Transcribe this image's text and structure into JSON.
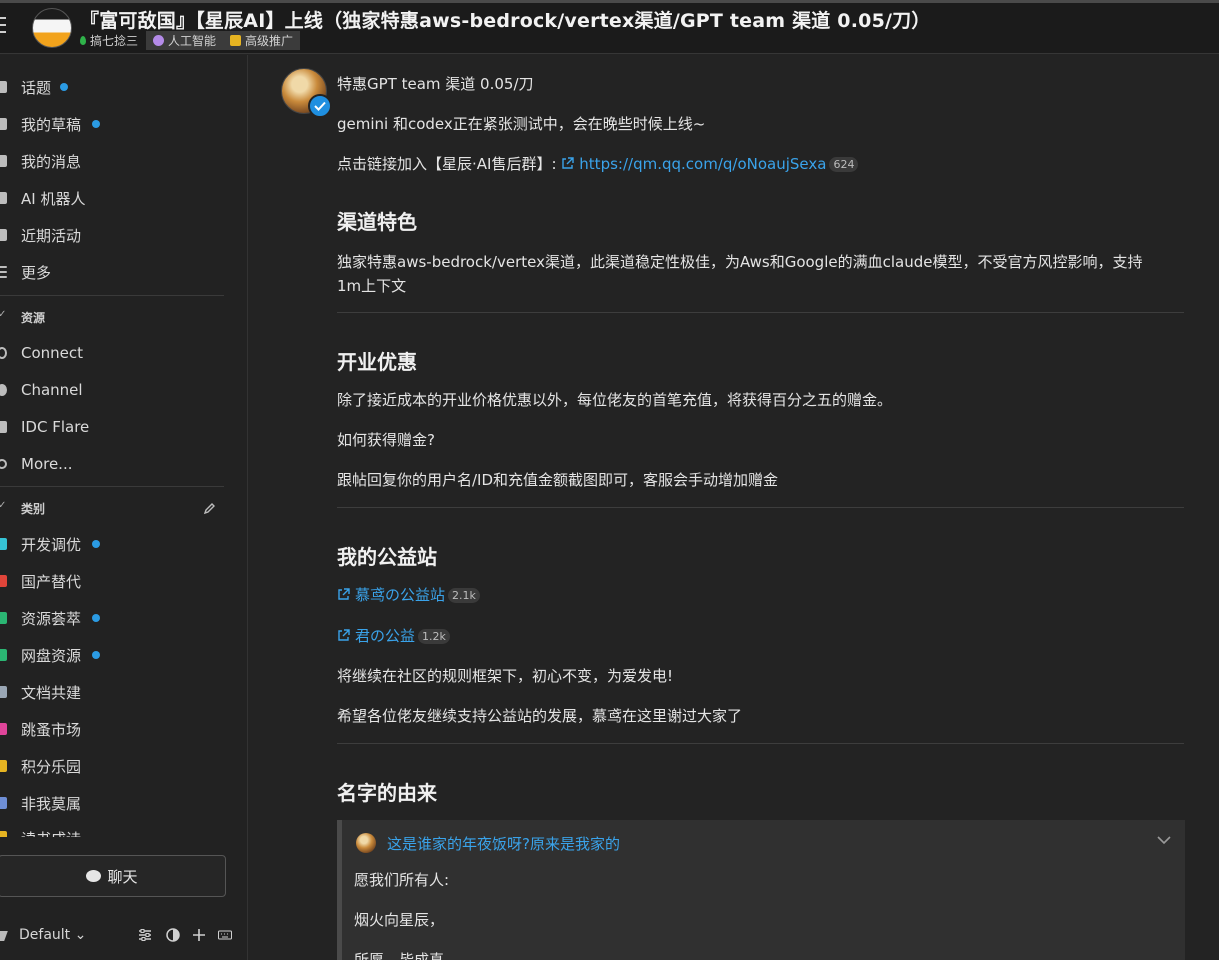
{
  "header": {
    "title": "『富可敌国』【星辰AI】上线（独家特惠aws-bedrock/vertex渠道/GPT team 渠道 0.05/刀）",
    "category": "搞七捻三",
    "tags": [
      "人工智能",
      "高级推广"
    ]
  },
  "sidebar": {
    "nav": [
      {
        "label": "话题",
        "unread": true
      },
      {
        "label": "我的草稿",
        "unread": true
      },
      {
        "label": "我的消息",
        "unread": false
      },
      {
        "label": "AI 机器人",
        "unread": false
      },
      {
        "label": "近期活动",
        "unread": false
      },
      {
        "label": "更多",
        "unread": false
      }
    ],
    "resources_heading": "资源",
    "resources": [
      "Connect",
      "Channel",
      "IDC Flare",
      "More..."
    ],
    "categories_heading": "类别",
    "categories": [
      {
        "label": "开发调优",
        "unread": true,
        "color": "#36c4d6"
      },
      {
        "label": "国产替代",
        "unread": false,
        "color": "#e0453a"
      },
      {
        "label": "资源荟萃",
        "unread": true,
        "color": "#2bb673"
      },
      {
        "label": "网盘资源",
        "unread": true,
        "color": "#2bb673"
      },
      {
        "label": "文档共建",
        "unread": false,
        "color": "#9aa7b5"
      },
      {
        "label": "跳蚤市场",
        "unread": false,
        "color": "#e0459a"
      },
      {
        "label": "积分乐园",
        "unread": false,
        "color": "#e6b422"
      },
      {
        "label": "非我莫属",
        "unread": false,
        "color": "#6f8fd6"
      },
      {
        "label": "读书成诗",
        "unread": false,
        "color": "#e6b422"
      }
    ],
    "chat_label": "聊天",
    "theme_label": "Default"
  },
  "post": {
    "line1": "特惠GPT team 渠道 0.05/刀",
    "line2": "gemini 和codex正在紧张测试中，会在晚些时候上线~",
    "join_prefix": "点击链接加入【星辰·AI售后群】:",
    "join_link": "https://qm.qq.com/q/oNoaujSexa",
    "join_count": "624",
    "sec1_title": "渠道特色",
    "sec1_text_a": "独家特惠aws-bedrock/vertex渠道，此渠道稳定性极佳，为Aws和Google的满血claude模型，不受官方风控影响，支持",
    "sec1_text_b": "1m上下文",
    "sec2_title": "开业优惠",
    "sec2_text1": "除了接近成本的开业价格优惠以外，每位佬友的首笔充值，将获得百分之五的赠金。",
    "sec2_text2": "如何获得赠金?",
    "sec2_text3": "跟帖回复你的用户名/ID和充值金额截图即可，客服会手动增加赠金",
    "sec3_title": "我的公益站",
    "site1": "慕鸢の公益站",
    "site1_count": "2.1k",
    "site2": "君の公益",
    "site2_count": "1.2k",
    "sec3_text1": "将继续在社区的规则框架下，初心不变，为爱发电!",
    "sec3_text2": "希望各位佬友继续支持公益站的发展，慕鸢在这里谢过大家了",
    "sec4_title": "名字的由来",
    "quote_title": "这是谁家的年夜饭呀?原来是我家的",
    "quote_lines": [
      "愿我们所有人:",
      "烟火向星辰，",
      "所愿，皆成真。"
    ]
  },
  "colors": {
    "accent": "#3aa3ea",
    "unread": "#2b9be3",
    "background": "#232323"
  }
}
